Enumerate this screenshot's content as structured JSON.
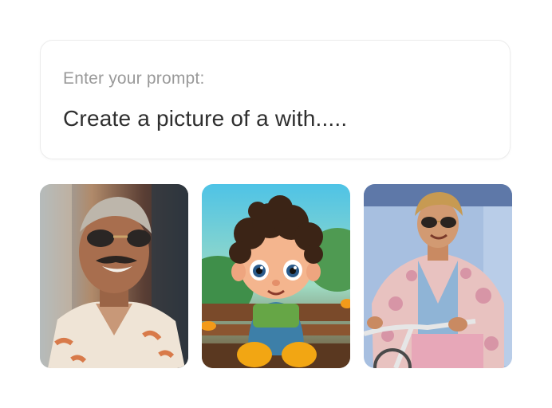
{
  "prompt": {
    "label": "Enter your prompt:",
    "value": "Create a picture of a with....."
  },
  "gallery": [
    {
      "subject": "smiling man with mustache and sunglasses"
    },
    {
      "subject": "cartoon boy with curly hair on bench"
    },
    {
      "subject": "man with sunglasses riding bicycle"
    }
  ]
}
